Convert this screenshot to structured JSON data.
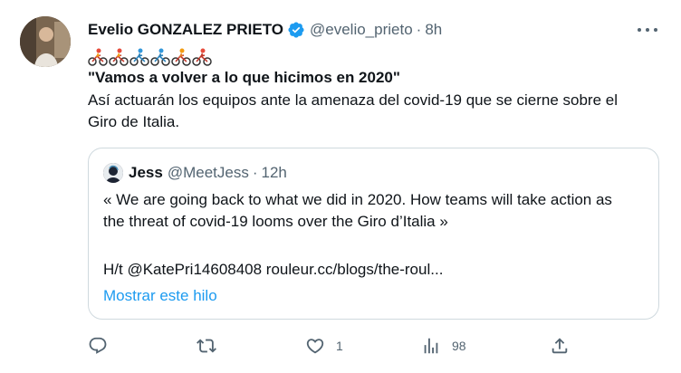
{
  "tweet": {
    "author_name": "Evelio GONZALEZ PRIETO",
    "handle": "@evelio_prieto",
    "separator": "·",
    "time": "8h",
    "emoji_count_note": "6 cyclist emojis",
    "headline": "\"Vamos a volver a lo que hicimos en 2020\"",
    "body": "Así actuarán los equipos ante la amenaza del covid-19 que se cierne sobre el Giro de Italia."
  },
  "quote": {
    "author_name": "Jess",
    "handle": "@MeetJess",
    "separator": "·",
    "time": "12h",
    "text": "« We are going back to what we did in 2020. How teams will take action as the threat of covid-19 looms over the Giro d’Italia »",
    "links": "H/t @KatePri14608408  rouleur.cc/blogs/the-roul...",
    "show_thread": "Mostrar este hilo"
  },
  "actions": {
    "reply_count": "",
    "retweet_count": "",
    "like_count": "1",
    "views_count": "98"
  },
  "colors": {
    "text": "#0f1419",
    "secondary": "#536471",
    "accent": "#1d9bf0",
    "border": "#cfd9de"
  },
  "icons": [
    "verified-badge-icon",
    "more-icon",
    "cyclist-emoji",
    "reply-icon",
    "retweet-icon",
    "like-icon",
    "views-icon",
    "share-icon"
  ]
}
